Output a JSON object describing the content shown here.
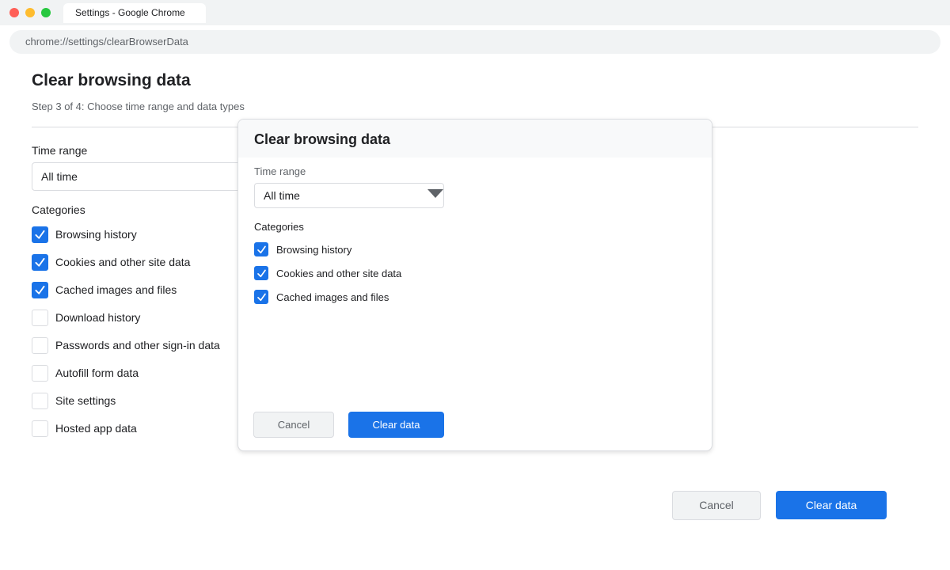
{
  "window": {
    "tab_title": "Settings - Google Chrome",
    "url": "chrome://settings/clearBrowserData"
  },
  "page": {
    "title": "Clear browsing data",
    "subtitle": "Step 3 of 4: Choose time range and data types",
    "time_range_label": "Time range",
    "time_range_value": "All time",
    "categories_label": "Categories",
    "categories": [
      {
        "label": "Browsing history",
        "checked": true
      },
      {
        "label": "Cookies and other site data",
        "checked": true
      },
      {
        "label": "Cached images and files",
        "checked": true
      },
      {
        "label": "Download history",
        "checked": false
      },
      {
        "label": "Passwords and other sign-in data",
        "checked": false
      },
      {
        "label": "Autofill form data",
        "checked": false
      },
      {
        "label": "Site settings",
        "checked": false
      },
      {
        "label": "Hosted app data",
        "checked": false
      }
    ],
    "cancel_label": "Cancel",
    "clear_label": "Clear data"
  },
  "dialog": {
    "title": "Clear browsing data",
    "time_range_label": "Time range",
    "time_range_value": "All time",
    "categories_label": "Categories",
    "categories": [
      {
        "label": "Browsing history",
        "checked": true
      },
      {
        "label": "Cookies and other site data",
        "checked": true
      },
      {
        "label": "Cached images and files",
        "checked": true
      }
    ],
    "cancel_label": "Cancel",
    "clear_label": "Clear data"
  },
  "colors": {
    "accent": "#1a73e8",
    "chrome_bg": "#f1f3f4"
  }
}
